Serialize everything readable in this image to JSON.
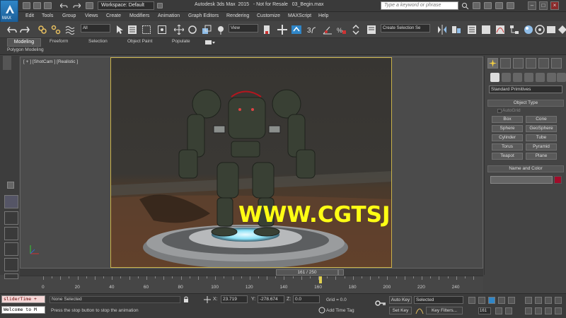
{
  "app": {
    "logo_text": "MAX",
    "title": "Autodesk 3ds Max  2015   - Not for Resale   03_Begin.max",
    "workspace": "Workspace: Default",
    "search_placeholder": "Type a keyword or phrase"
  },
  "menu": [
    "Edit",
    "Tools",
    "Group",
    "Views",
    "Create",
    "Modifiers",
    "Animation",
    "Graph Editors",
    "Rendering",
    "Customize",
    "MAXScript",
    "Help"
  ],
  "toolbar": {
    "filter_dropdown": "All",
    "view_dropdown": "View",
    "selection_set": "Create Selection Se"
  },
  "ribbon": {
    "tabs": [
      "Modeling",
      "Freeform",
      "Selection",
      "Object Paint",
      "Populate"
    ],
    "sub_label": "Polygon Modeling"
  },
  "viewport": {
    "label": "[ + ] [ShotCam ] [Realistic ]",
    "watermark": "WWW.CGTSJ.COM"
  },
  "command_panel": {
    "category": "Standard Primitives",
    "object_type_title": "Object Type",
    "autogrid_label": "AutoGrid",
    "primitives": [
      "Box",
      "Cone",
      "Sphere",
      "GeoSphere",
      "Cylinder",
      "Tube",
      "Torus",
      "Pyramid",
      "Teapot",
      "Plane"
    ],
    "name_color_title": "Name and Color",
    "object_color": "#a00c2a"
  },
  "timeline": {
    "slider_text": "161 / 250",
    "current_frame": 161,
    "total_frames": 250,
    "ticks": [
      "0",
      "20",
      "40",
      "60",
      "80",
      "100",
      "120",
      "140",
      "160",
      "180",
      "200",
      "220",
      "240"
    ]
  },
  "status": {
    "maxscript_line1": "sliderTime +",
    "maxscript_line2": "Welcome to M",
    "selection": "None Selected",
    "prompt": "Press the stop button to stop the animation",
    "x_label": "X:",
    "x_value": "23.719",
    "y_label": "Y:",
    "y_value": "-278.674",
    "z_label": "Z:",
    "z_value": "0.0",
    "grid": "Grid = 0.0",
    "add_time_tag": "Add Time Tag",
    "auto_key": "Auto Key",
    "set_key": "Set Key",
    "key_mode": "Selected",
    "key_filters": "Key Filters...",
    "frame": "161"
  }
}
